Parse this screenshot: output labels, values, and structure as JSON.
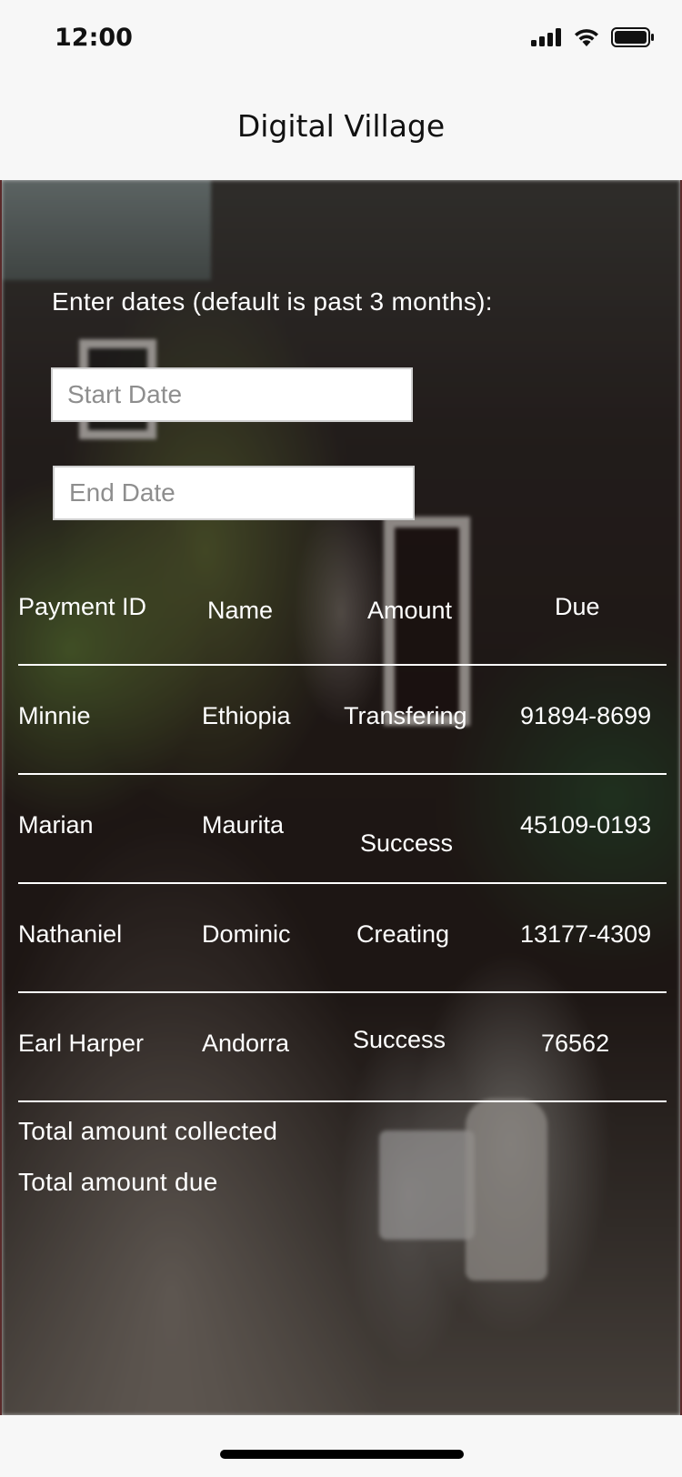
{
  "status_bar": {
    "time": "12:00",
    "icons": [
      "signal-icon",
      "wifi-icon",
      "battery-icon"
    ]
  },
  "nav": {
    "title": "Digital Village"
  },
  "form": {
    "prompt": "Enter dates (default is past 3 months):",
    "start_date_placeholder": "Start Date",
    "end_date_placeholder": "End Date"
  },
  "table": {
    "headers": [
      "Payment ID",
      "Name",
      "Amount",
      "Due"
    ],
    "rows": [
      [
        "Minnie",
        "Ethiopia",
        "Transfering",
        "91894-8699"
      ],
      [
        "Marian",
        "Maurita",
        "Success",
        "45109-0193"
      ],
      [
        "Nathaniel",
        "Dominic",
        "Creating",
        "13177-4309"
      ],
      [
        "Earl Harper",
        "Andorra",
        "Success",
        "76562"
      ]
    ]
  },
  "totals": {
    "collected_label": "Total amount collected",
    "due_label": "Total amount due"
  },
  "colors": {
    "text_on_photo": "#ffffff",
    "divider": "#ffffff",
    "page_background": "#f7f7f7"
  }
}
